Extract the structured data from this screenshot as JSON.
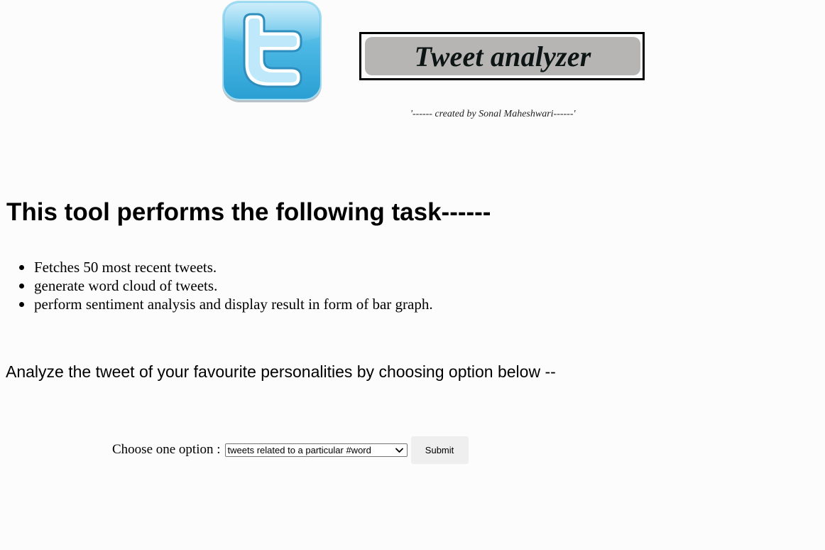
{
  "header": {
    "logo_icon": "twitter-bird-t-logo-icon",
    "logo_color": "#4cb8e4",
    "title": "Tweet analyzer",
    "credit": "'------ created by Sonal Maheshwari------'"
  },
  "main": {
    "heading": "This tool performs the following task------",
    "tasks": [
      "Fetches 50 most recent tweets.",
      "generate word cloud of tweets.",
      "perform sentiment analysis and display result in form of bar graph."
    ],
    "analyze_prompt": "Analyze the tweet of your favourite personalities by choosing option below --"
  },
  "form": {
    "choose_label": "Choose one option :",
    "selected_option": "tweets related to a particular #word",
    "dropdown_icon": "chevron-down-icon",
    "submit_label": "Submit"
  }
}
